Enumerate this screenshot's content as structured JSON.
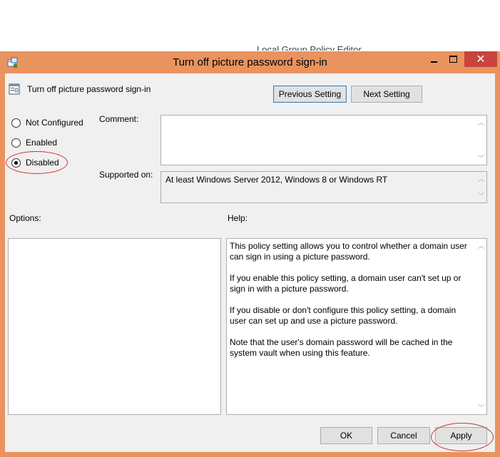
{
  "background_title": "Local Group Policy Editor",
  "window": {
    "title": "Turn off picture password sign-in",
    "accent_color": "#e9935f",
    "close_color": "#c7453c"
  },
  "policy": {
    "name": "Turn off picture password sign-in"
  },
  "nav": {
    "previous_label": "Previous Setting",
    "next_label": "Next Setting"
  },
  "state": {
    "options": [
      {
        "label": "Not Configured",
        "checked": false
      },
      {
        "label": "Enabled",
        "checked": false
      },
      {
        "label": "Disabled",
        "checked": true
      }
    ]
  },
  "comment": {
    "label": "Comment:",
    "value": ""
  },
  "supported": {
    "label": "Supported on:",
    "value": "At least Windows Server 2012, Windows 8 or Windows RT"
  },
  "options_label": "Options:",
  "help_label": "Help:",
  "help": {
    "paragraphs": [
      "This policy setting allows you to control whether a domain user can sign in using a picture password.",
      "If you enable this policy setting, a domain user can't set up or sign in with a picture password.",
      "If you disable or don't configure this policy setting, a domain user can set up and use a picture password.",
      "Note that the user's domain password will be cached in the system vault when using this feature."
    ]
  },
  "buttons": {
    "ok": "OK",
    "cancel": "Cancel",
    "apply": "Apply"
  },
  "annotation_color": "#d32f2f"
}
